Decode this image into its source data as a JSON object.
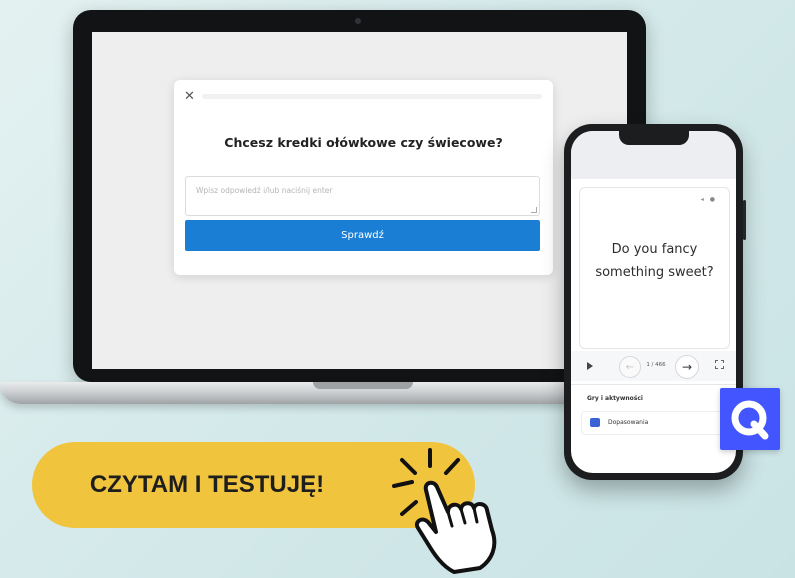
{
  "laptop": {
    "quiz": {
      "close_glyph": "✕",
      "question": "Chcesz kredki ołówkowe czy świecowe?",
      "input_placeholder": "Wpisz odpowiedź i/lub naciśnij enter",
      "submit_label": "Sprawdź"
    }
  },
  "phone": {
    "flashcard": {
      "line1": "Do you fancy",
      "line2": "something sweet?",
      "icons": [
        "speaker-icon",
        "star-icon"
      ]
    },
    "controls": {
      "prev_glyph": "←",
      "counter": "1 / 466",
      "next_glyph": "→"
    },
    "section_title": "Gry i aktywności",
    "activity_label": "Dopasowania"
  },
  "brand": {
    "logo_icon": "quizlet-q-icon",
    "color": "#4255ff"
  },
  "cta": {
    "label": "CZYTAM I TESTUJĘ!",
    "color": "#f0c43c",
    "icon": "pointing-hand-click-icon"
  },
  "colors": {
    "accent_blue": "#1a7fd4",
    "background": "#d2e8e9"
  }
}
